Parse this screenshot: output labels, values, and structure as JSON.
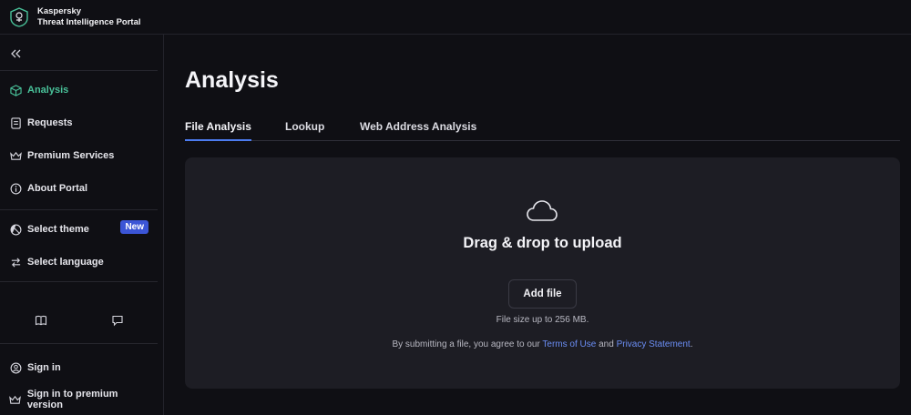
{
  "brand": {
    "line1": "Kaspersky",
    "line2": "Threat Intelligence Portal"
  },
  "sidebar": {
    "nav": [
      {
        "label": "Analysis",
        "icon": "cube-icon",
        "active": true
      },
      {
        "label": "Requests",
        "icon": "document-icon"
      },
      {
        "label": "Premium Services",
        "icon": "crown-icon"
      },
      {
        "label": "About Portal",
        "icon": "info-icon"
      }
    ],
    "settings": [
      {
        "label": "Select theme",
        "icon": "theme-icon",
        "badge": "New"
      },
      {
        "label": "Select language",
        "icon": "arrows-icon"
      }
    ],
    "auth": [
      {
        "label": "Sign in",
        "icon": "user-icon"
      },
      {
        "label": "Sign in to premium version",
        "icon": "crown-icon"
      }
    ]
  },
  "main": {
    "title": "Analysis",
    "tabs": [
      "File Analysis",
      "Lookup",
      "Web Address Analysis"
    ],
    "active_tab": "File Analysis",
    "upload": {
      "heading": "Drag & drop to upload",
      "button": "Add file",
      "size_note": "File size up to 256 MB.",
      "terms_prefix": "By submitting a file, you agree to our",
      "terms_link": "Terms of Use",
      "terms_and": "and",
      "privacy_link": "Privacy Statement",
      "terms_suffix": "."
    }
  },
  "colors": {
    "accent_active": "#49c29a",
    "link": "#6b8ef5",
    "badge": "#3b55d6",
    "tab_underline": "#4c7cf0"
  }
}
